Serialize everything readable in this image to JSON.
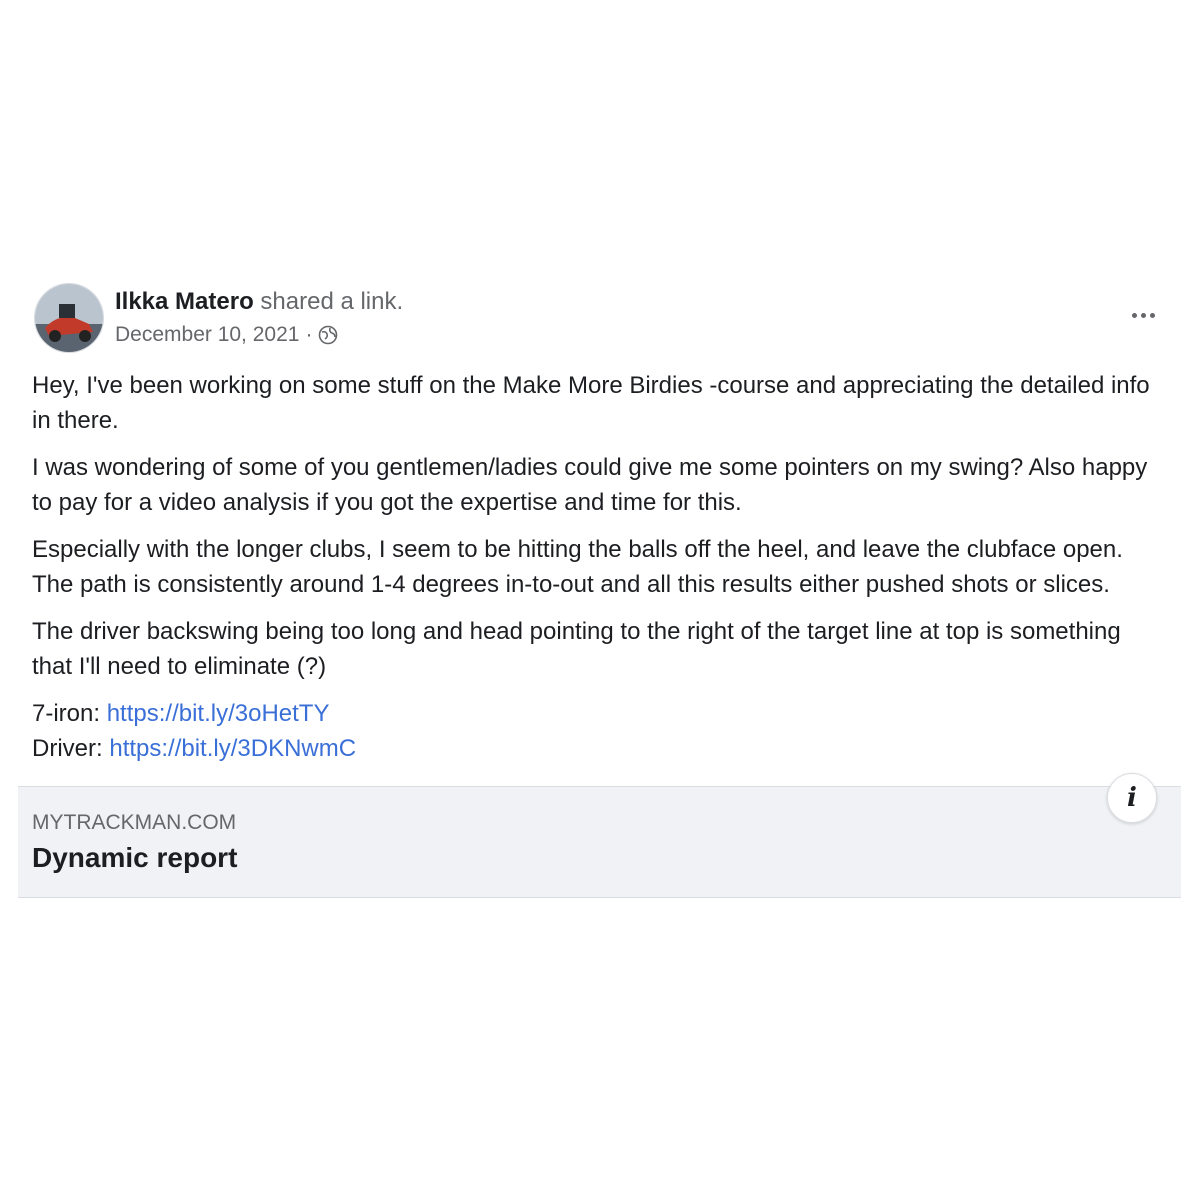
{
  "post": {
    "author": "Ilkka Matero",
    "action": " shared a link.",
    "date": "December 10, 2021",
    "separator": " · ",
    "audience_icon": "globe-icon",
    "more_icon": "more-options-icon",
    "paragraphs": [
      "Hey, I've been working on some stuff on the Make More Birdies -course and appreciating the detailed info in there.",
      "I was wondering of some of you gentlemen/ladies could give me some pointers on my swing? Also happy to pay for a video analysis if you got the expertise and time for this.",
      "Especially with the longer clubs, I seem to be hitting the balls off the heel, and leave the clubface open. The path is consistently around 1-4 degrees in-to-out and all this results either pushed shots or slices.",
      "The driver backswing being too long and head pointing to the right of the target line at top is something that I'll need to eliminate (?)"
    ],
    "links": [
      {
        "label": "7-iron: ",
        "url": "https://bit.ly/3oHetTY"
      },
      {
        "label": "Driver: ",
        "url": "https://bit.ly/3DKNwmC"
      }
    ]
  },
  "preview": {
    "domain": "MYTRACKMAN.COM",
    "title": "Dynamic report",
    "info_icon": "info-icon",
    "info_glyph": "i"
  },
  "colors": {
    "link": "#3a6fd8",
    "secondary_text": "#65676b",
    "preview_bg": "#f0f2f5"
  }
}
